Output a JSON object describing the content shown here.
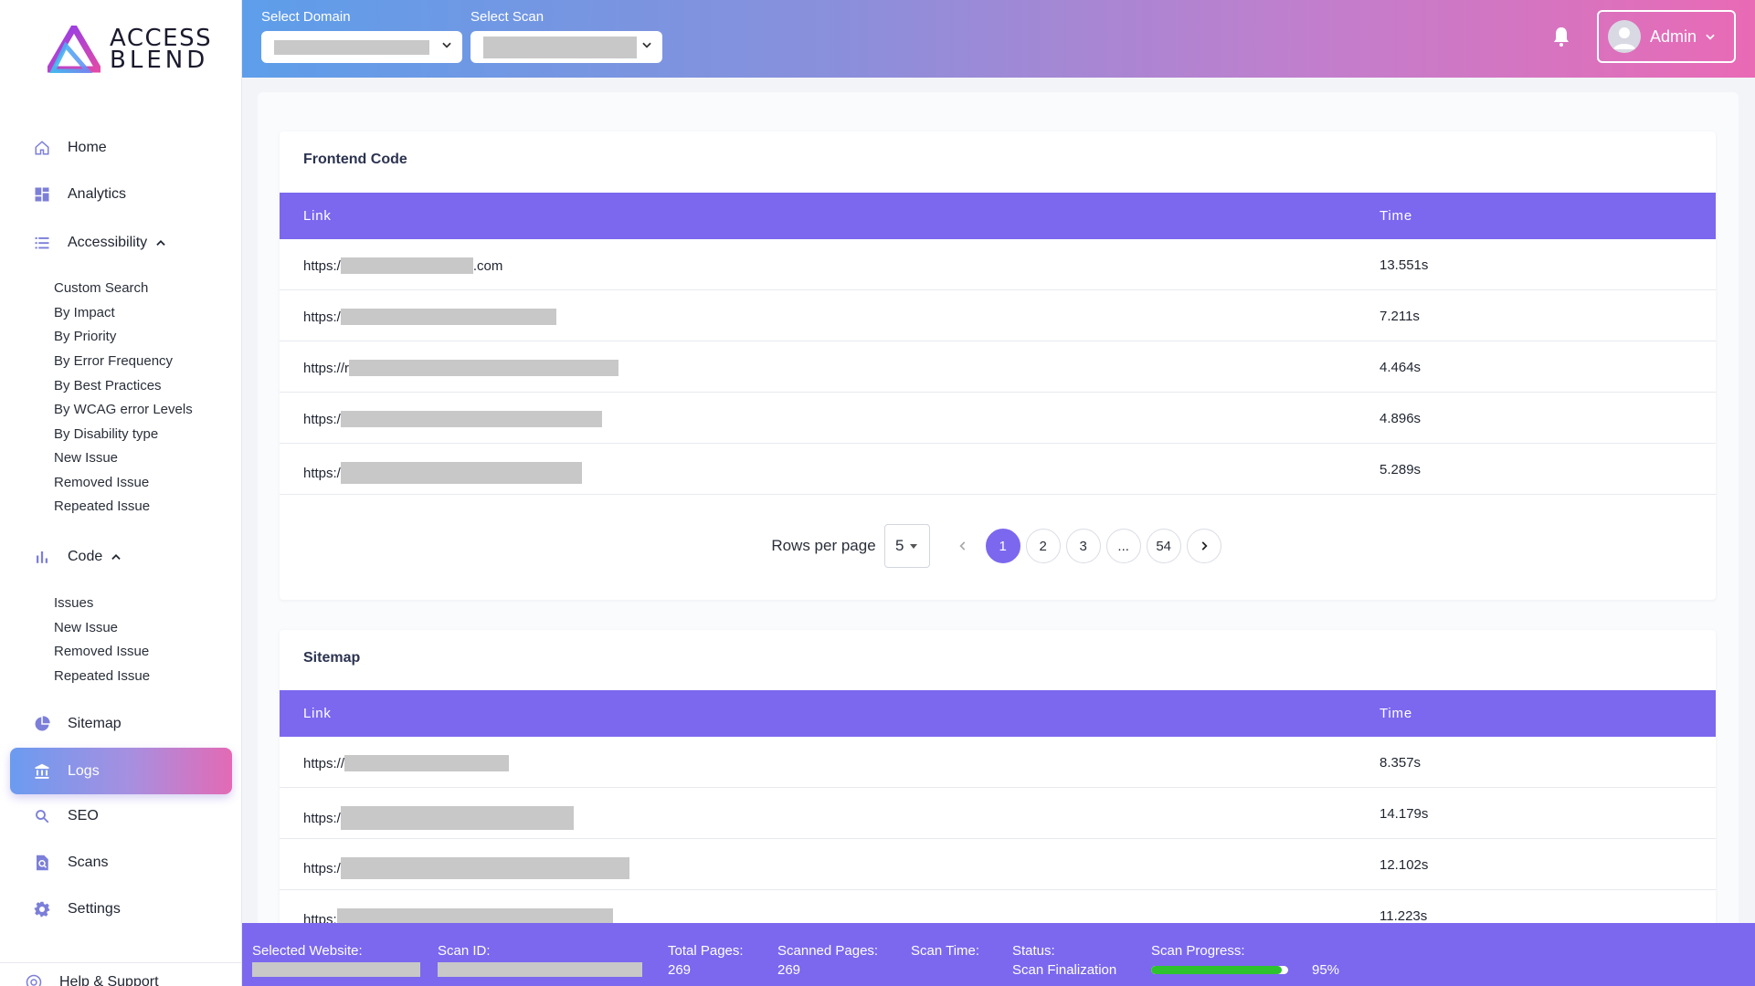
{
  "logo": {
    "line1": "ACCESS",
    "line2": "BLEND"
  },
  "sidebar": {
    "items": [
      {
        "label": "Home",
        "icon": "home-icon"
      },
      {
        "label": "Analytics",
        "icon": "dashboard-icon"
      },
      {
        "label": "Accessibility",
        "icon": "list-icon",
        "expanded": true
      },
      {
        "label": "Code",
        "icon": "bar-chart-icon",
        "expanded": true
      },
      {
        "label": "Sitemap",
        "icon": "pie-chart-icon"
      },
      {
        "label": "Logs",
        "icon": "bank-icon",
        "active": true
      },
      {
        "label": "SEO",
        "icon": "search-icon"
      },
      {
        "label": "Scans",
        "icon": "scan-search-icon"
      },
      {
        "label": "Settings",
        "icon": "gear-icon"
      }
    ],
    "accessibility_sub": [
      "Custom Search",
      "By Impact",
      "By Priority",
      "By Error Frequency",
      "By Best Practices",
      "By WCAG error Levels",
      "By Disability type",
      "New Issue",
      "Removed Issue",
      "Repeated Issue"
    ],
    "code_sub": [
      "Issues",
      "New Issue",
      "Removed Issue",
      "Repeated Issue"
    ],
    "footer_label": "Help & Support"
  },
  "header": {
    "domain_label": "Select Domain",
    "scan_label": "Select Scan",
    "domain_value": "",
    "scan_value": "",
    "user_label": "Admin"
  },
  "frontend": {
    "title": "Frontend Code",
    "col_link": "Link",
    "col_time": "Time",
    "rows": [
      {
        "link_prefix": "https:/",
        "link_suffix": ".com",
        "time": "13.551s"
      },
      {
        "link_prefix": "https:/",
        "link_suffix": "",
        "time": "7.211s"
      },
      {
        "link_prefix": "https://r",
        "link_suffix": "",
        "time": "4.464s"
      },
      {
        "link_prefix": "https:/",
        "link_suffix": "",
        "time": "4.896s"
      },
      {
        "link_prefix": "https:/",
        "link_suffix": "",
        "time": "5.289s"
      }
    ],
    "pager": {
      "rows_per_page_label": "Rows per page",
      "rows_per_page": "5",
      "pages": [
        "1",
        "2",
        "3",
        "...",
        "54"
      ],
      "current": "1"
    }
  },
  "sitemap": {
    "title": "Sitemap",
    "col_link": "Link",
    "col_time": "Time",
    "rows": [
      {
        "link_prefix": "https://",
        "time": "8.357s"
      },
      {
        "link_prefix": "https:/",
        "time": "14.179s"
      },
      {
        "link_prefix": "https:/",
        "time": "12.102s"
      },
      {
        "link_prefix": "https:",
        "time": "11.223s"
      }
    ]
  },
  "status": {
    "selected_website_label": "Selected Website:",
    "scan_id_label": "Scan ID:",
    "total_pages_label": "Total Pages:",
    "total_pages": "269",
    "scanned_pages_label": "Scanned Pages:",
    "scanned_pages": "269",
    "scan_time_label": "Scan Time:",
    "status_label": "Status:",
    "status_value": "Scan Finalization",
    "progress_label": "Scan Progress:",
    "progress_text": "95%",
    "progress_fraction": 0.95,
    "progress_color": "#2ec22e"
  },
  "colors": {
    "accent": "#7b68ee",
    "gradient_start": "#5d9eea",
    "gradient_end": "#e96ab5"
  }
}
